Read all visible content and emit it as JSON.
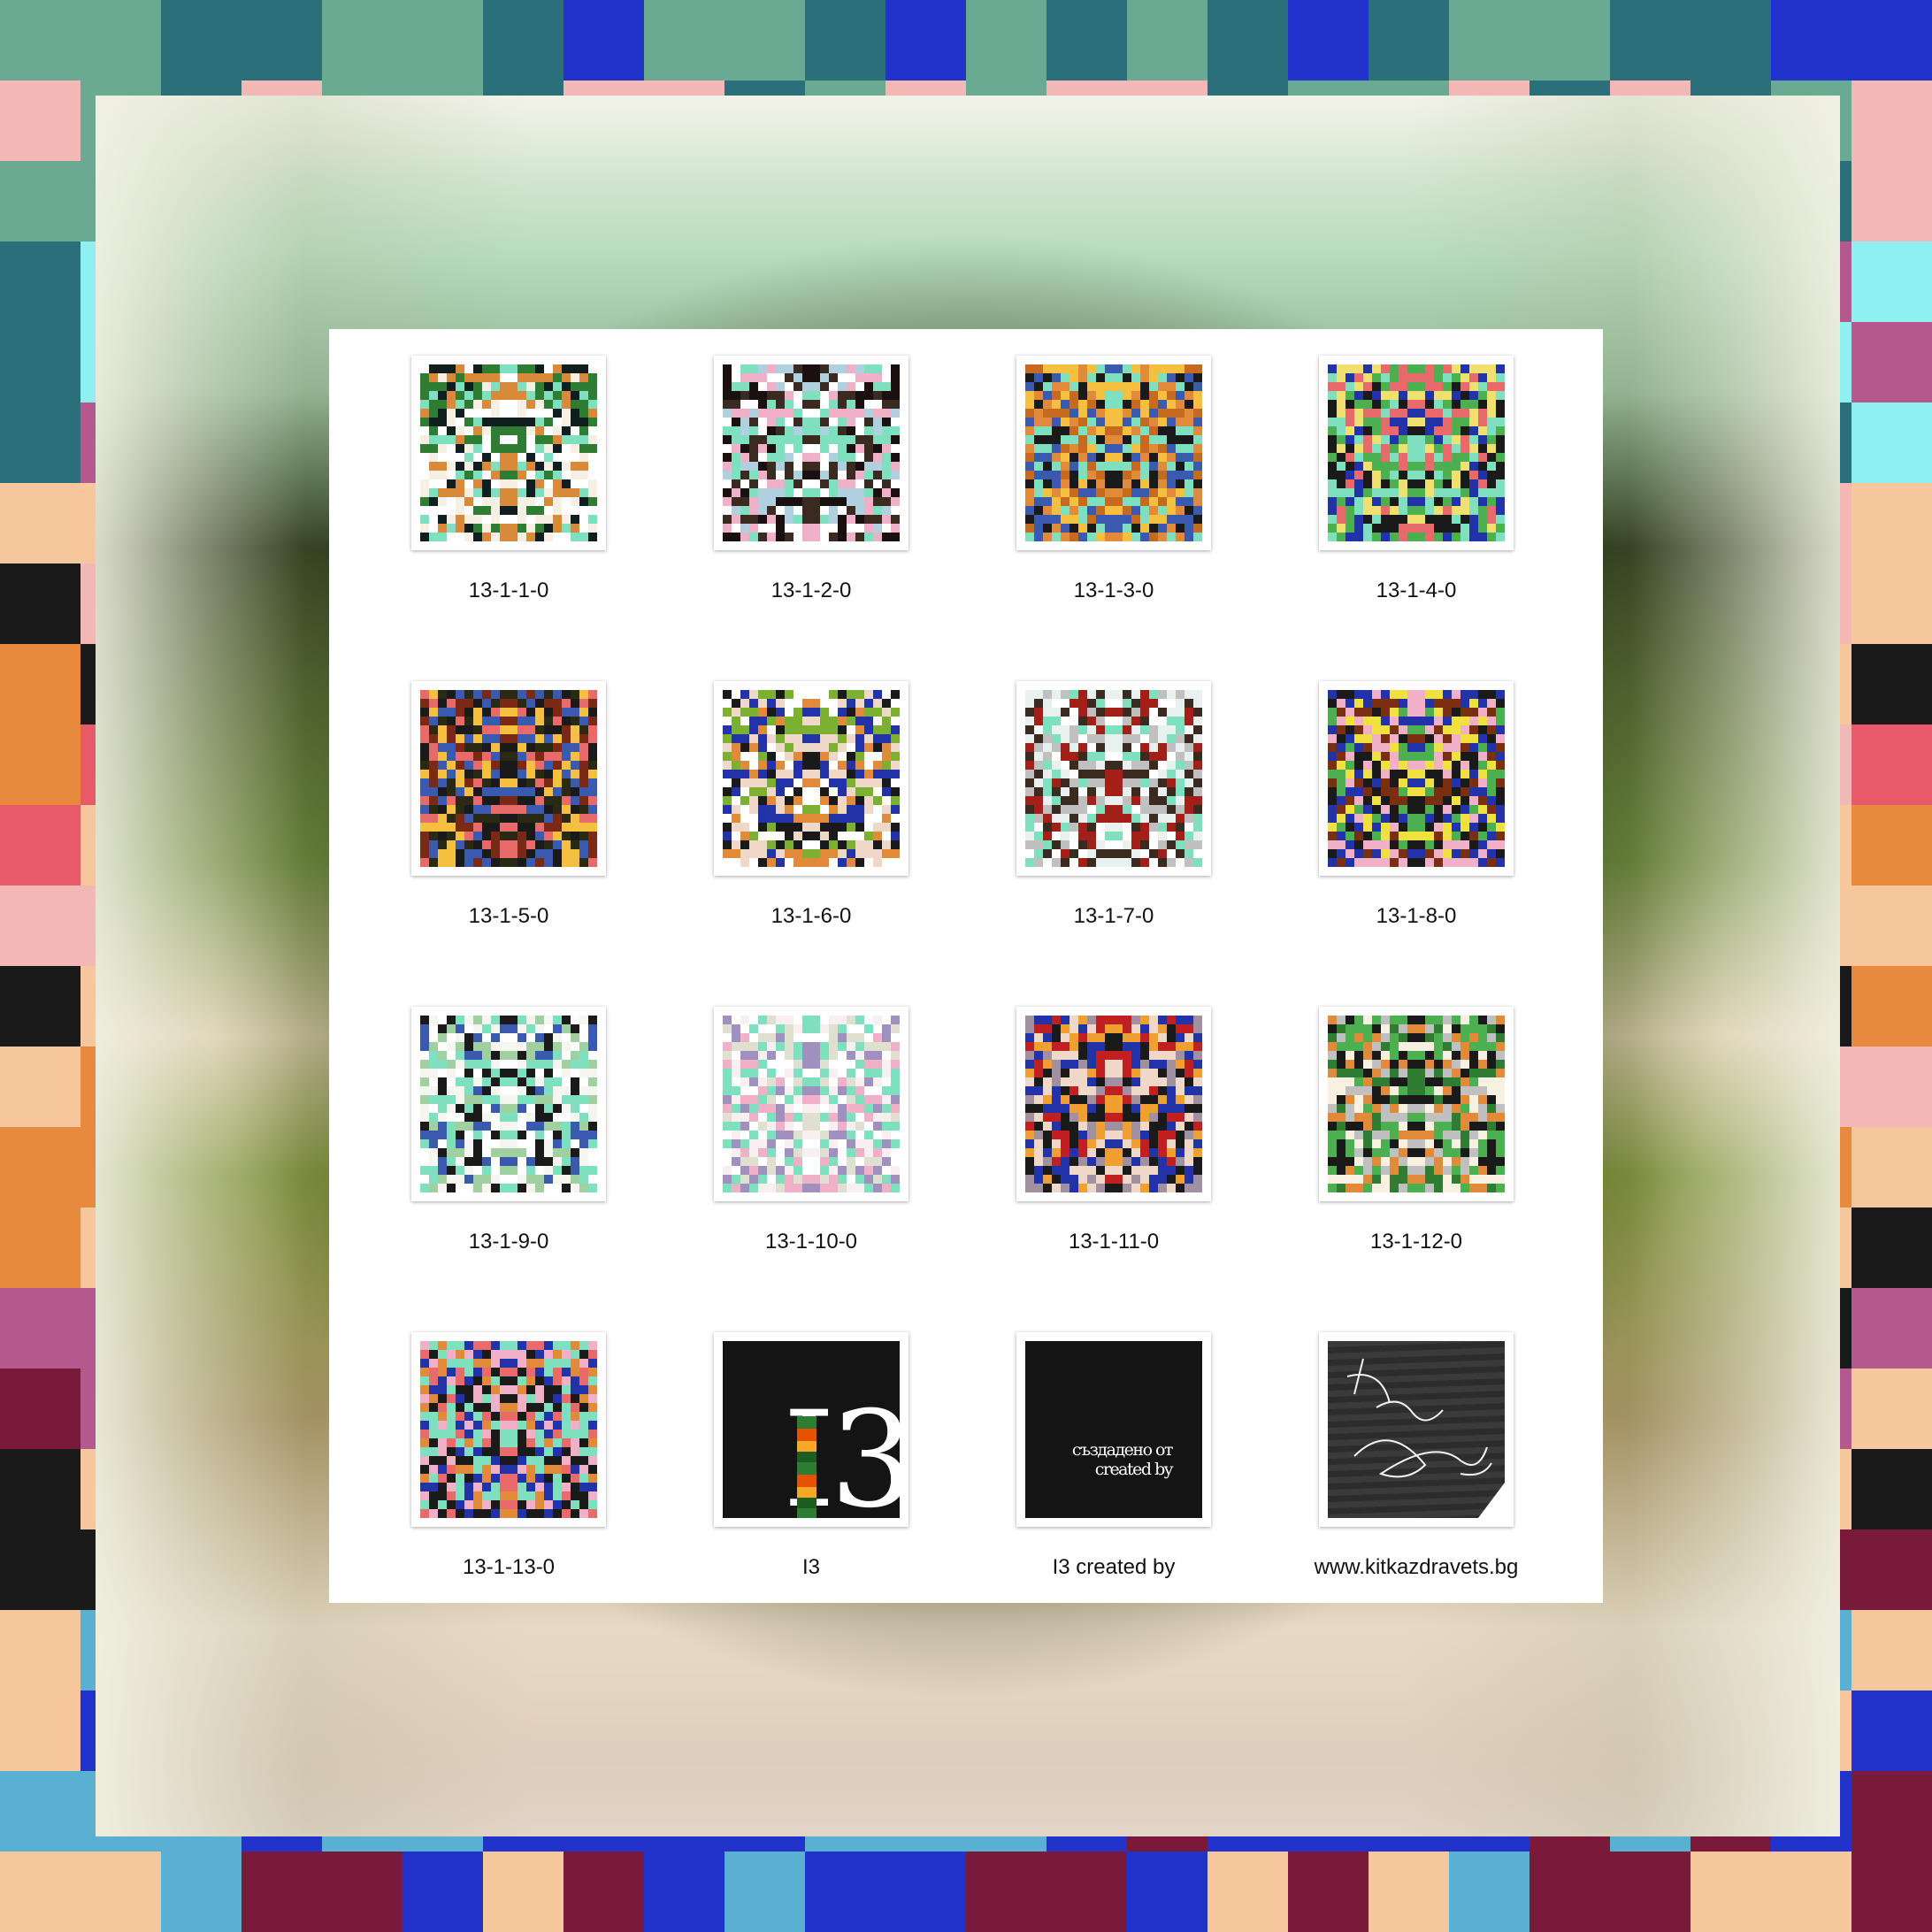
{
  "window": {
    "items": [
      {
        "label": "13-1-1-0",
        "kind": "pattern",
        "palette": [
          "#f6f0e4",
          "#0f1f1f",
          "#7fe0c0",
          "#2e7d32",
          "#d88a3a",
          "#ffffff"
        ]
      },
      {
        "label": "13-1-2-0",
        "kind": "pattern",
        "palette": [
          "#1a1010",
          "#f0b0c8",
          "#7fe0c0",
          "#b0d0e0",
          "#ffffff",
          "#3a2a20"
        ]
      },
      {
        "label": "13-1-3-0",
        "kind": "pattern",
        "palette": [
          "#7fe0c0",
          "#c66a20",
          "#1a1a1a",
          "#f5c040",
          "#3a5ab0",
          "#e08a3a"
        ]
      },
      {
        "label": "13-1-4-0",
        "kind": "pattern",
        "palette": [
          "#1a1a1a",
          "#e86a6a",
          "#4caf50",
          "#2233aa",
          "#f0e070",
          "#7fe0c0"
        ]
      },
      {
        "label": "13-1-5-0",
        "kind": "pattern",
        "palette": [
          "#2a2a14",
          "#f5c040",
          "#7a2a14",
          "#3a5ab0",
          "#e86a6a",
          "#1a1a1a"
        ]
      },
      {
        "label": "13-1-6-0",
        "kind": "pattern",
        "palette": [
          "#f0d8c8",
          "#2233aa",
          "#7bb030",
          "#e08a3a",
          "#ffffff",
          "#1a1a1a"
        ]
      },
      {
        "label": "13-1-7-0",
        "kind": "pattern",
        "palette": [
          "#a32018",
          "#e8f0f0",
          "#c0c0c0",
          "#7fe0c0",
          "#ffffff",
          "#3a2a20"
        ]
      },
      {
        "label": "13-1-8-0",
        "kind": "pattern",
        "palette": [
          "#7a3010",
          "#f0e040",
          "#2233aa",
          "#4caf50",
          "#1a1a1a",
          "#f0b0c8"
        ]
      },
      {
        "label": "13-1-9-0",
        "kind": "pattern",
        "palette": [
          "#3a5ab0",
          "#f6f6f0",
          "#7fe0c0",
          "#1a1a1a",
          "#a0d0a0",
          "#ffffff"
        ]
      },
      {
        "label": "13-1-10-0",
        "kind": "pattern",
        "palette": [
          "#f8f0f0",
          "#7fe0c0",
          "#f0b0c8",
          "#e0e0d0",
          "#ffffff",
          "#a090c0"
        ]
      },
      {
        "label": "13-1-11-0",
        "kind": "pattern",
        "palette": [
          "#a090a0",
          "#2233aa",
          "#f0a030",
          "#1a1a1a",
          "#f0d8c8",
          "#c02020"
        ]
      },
      {
        "label": "13-1-12-0",
        "kind": "pattern",
        "palette": [
          "#4caf50",
          "#f8f0e0",
          "#e08a3a",
          "#1a1a1a",
          "#c0c0c0",
          "#2e7d32"
        ]
      },
      {
        "label": "13-1-13-0",
        "kind": "pattern",
        "palette": [
          "#1a1a1a",
          "#7fe0c0",
          "#2233aa",
          "#f0b0c8",
          "#e08a3a",
          "#e86a6a"
        ]
      },
      {
        "label": "I3",
        "kind": "i3",
        "art_text": "I3"
      },
      {
        "label": "I3 created by",
        "kind": "created",
        "art_lines": [
          "създадено от",
          "created by"
        ]
      },
      {
        "label": "www.kitkazdravets.bg",
        "kind": "signature"
      }
    ]
  },
  "colors": {
    "window_bg": "#ffffff",
    "mosaic": [
      "#2a6f7a",
      "#6aaa92",
      "#f3b7b5",
      "#b4588e",
      "#ffffff",
      "#8ef0f0",
      "#e88a3e",
      "#f6c79c",
      "#e85a6a",
      "#1a1a1a",
      "#7a1a3a",
      "#2233cc",
      "#5ab0d0"
    ]
  }
}
